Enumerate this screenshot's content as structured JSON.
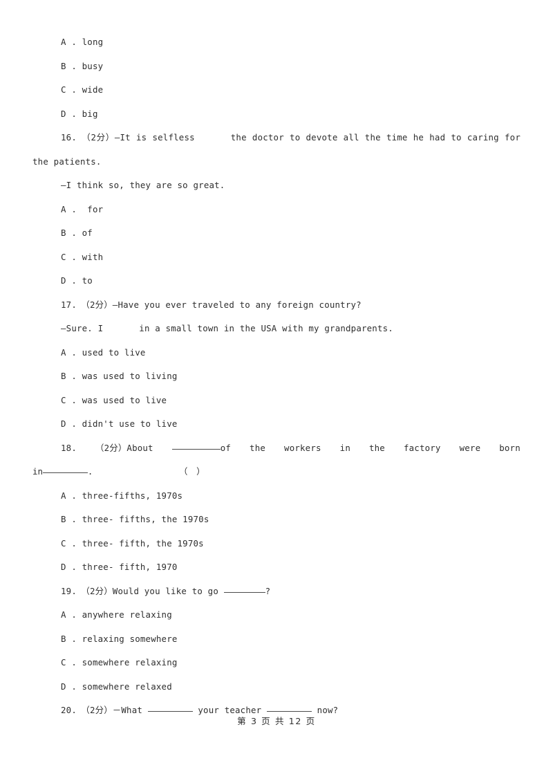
{
  "document": {
    "page_footer": "第 3 页 共 12 页",
    "page_number": "3",
    "total_pages": "12"
  },
  "questions": [
    {
      "id": "q15-options",
      "options": [
        "A . long",
        "B . busy",
        "C . wide",
        "D . big"
      ]
    },
    {
      "id": "q16",
      "number": "16.",
      "score": "（2分）",
      "stem_part1": "—It is selfless",
      "stem_part2": "the doctor to devote all the time he had to caring for the patients.",
      "stem_line1": "16.　（2分）—It is selfless",
      "stem_line1_after": "the doctor to devote all the time he had to caring for the",
      "stem_line2": "patients.",
      "reply": "—I think so, they are so great.",
      "options": [
        "A .  for",
        "B . of",
        "C . with",
        "D . to"
      ]
    },
    {
      "id": "q17",
      "number": "17.",
      "score": "（2分）",
      "stem": "17.　（2分）—Have you ever traveled to any foreign country?",
      "reply_part1": "—Sure. I",
      "reply_part2": "in a small town in the USA with my grandparents.",
      "options": [
        "A . used to live",
        "B . was used to living",
        "C . was used to live",
        "D . didn't use to live"
      ]
    },
    {
      "id": "q18",
      "number": "18.",
      "score": "（2分）",
      "stem_words": [
        "18.",
        "（2分）About",
        "of",
        "the",
        "workers",
        "in",
        "the",
        "factory",
        "were",
        "born"
      ],
      "stem_line2_prefix": "in",
      "stem_line2_suffix": ".",
      "answer_parens": "（　）",
      "options": [
        "A . three-fifths, 1970s",
        "B . three- fifths, the 1970s",
        "C . three- fifth, the 1970s",
        "D . three- fifth, 1970"
      ]
    },
    {
      "id": "q19",
      "number": "19.",
      "score": "（2分）",
      "stem_part1": "19.　（2分）Would you like to go",
      "stem_part2": "?",
      "options": [
        "A . anywhere relaxing",
        "B . relaxing somewhere",
        "C . somewhere relaxing",
        "D . somewhere relaxed"
      ]
    },
    {
      "id": "q20",
      "number": "20.",
      "score": "（2分）",
      "stem_part1": "20.　（2分）－What",
      "stem_part2": "your teacher",
      "stem_part3": "now?"
    }
  ],
  "colors": {
    "page_background": "#ffffff",
    "text": "#2e2e2e",
    "rule": "#4a4a4a"
  }
}
